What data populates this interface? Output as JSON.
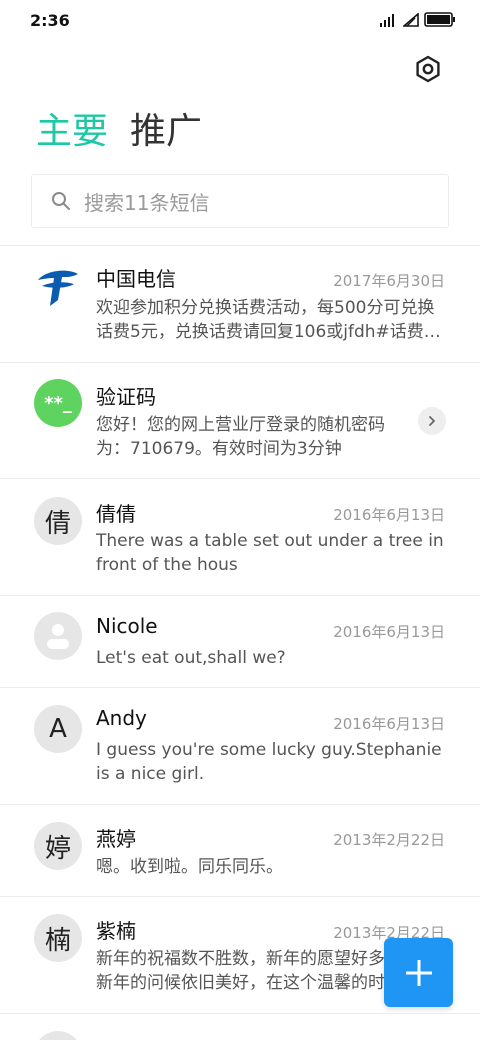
{
  "status_bar": {
    "time": "2:36",
    "icons": [
      "signal-icon",
      "wifi-icon",
      "battery-icon"
    ]
  },
  "header": {
    "settings_icon": "hexagon-settings-icon"
  },
  "tabs": [
    {
      "label": "主要",
      "active": true
    },
    {
      "label": "推广",
      "active": false
    }
  ],
  "search": {
    "placeholder": "搜索11条短信"
  },
  "messages": [
    {
      "name": "中国电信",
      "date": "2017年6月30日",
      "text": "欢迎参加积分兑换话费活动，每500分可兑换话费5元，兑换话费请回复106或jfdh#话费…",
      "avatar": "china-telecom-logo"
    },
    {
      "name": "验证码",
      "date": "",
      "text": "您好！您的网上营业厅登录的随机密码为：710679。有效时间为3分钟",
      "avatar_text": "**_"
    },
    {
      "name": "倩倩",
      "date": "2016年6月13日",
      "text": "There was a table set out under a tree in front of the hous",
      "avatar_text": "倩"
    },
    {
      "name": "Nicole",
      "date": "2016年6月13日",
      "text": "Let's eat out,shall we?",
      "avatar": "person-placeholder-icon"
    },
    {
      "name": "Andy",
      "date": "2016年6月13日",
      "text": "I guess you're some lucky guy.Stephanie is a nice girl.",
      "avatar_text": "A"
    },
    {
      "name": "燕婷",
      "date": "2013年2月22日",
      "text": "嗯。收到啦。同乐同乐。",
      "avatar_text": "婷"
    },
    {
      "name": "紫楠",
      "date": "2013年2月22日",
      "text": "新年的祝福数不胜数，新年的愿望好多好多，新年的问候依旧美好，在这个温馨的时刻",
      "avatar_text": "楠"
    }
  ],
  "fab": {
    "icon": "plus-icon"
  },
  "colors": {
    "accent": "#1ec8a5",
    "fab": "#1f96f3",
    "verify_avatar": "#5fd35f",
    "telecom_blue": "#0b5cae"
  }
}
